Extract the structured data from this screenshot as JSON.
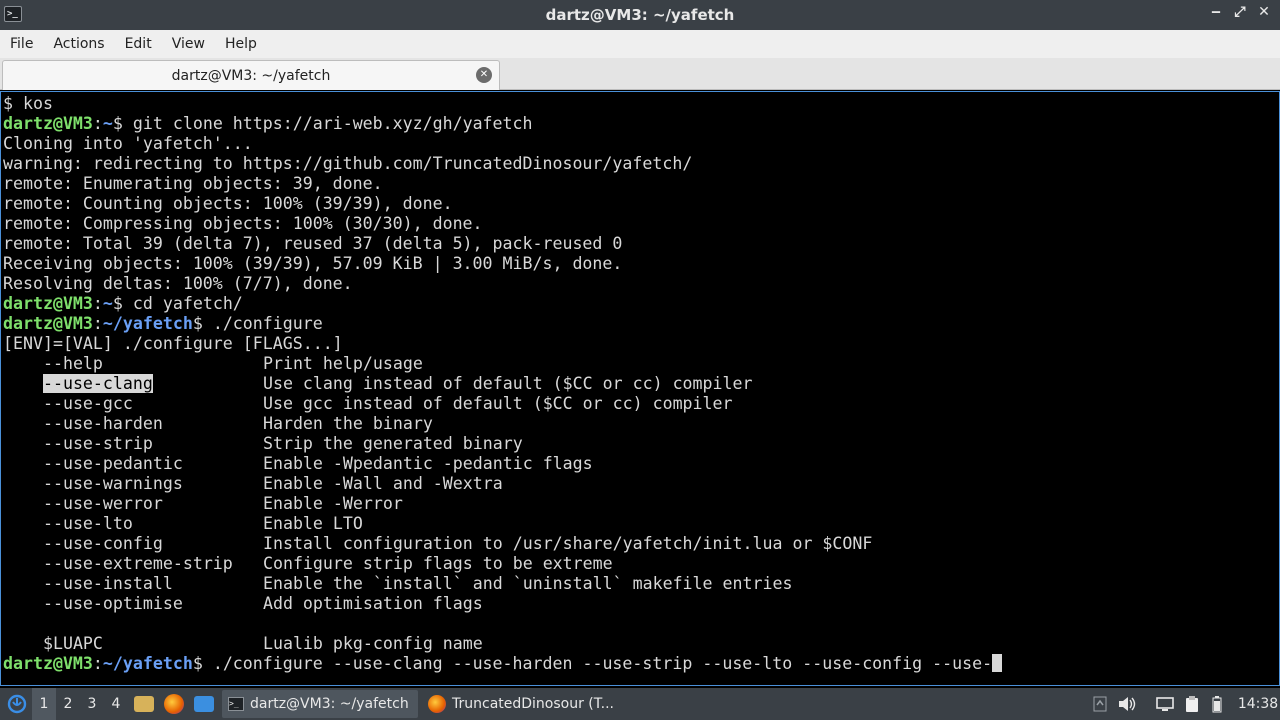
{
  "window": {
    "title": "dartz@VM3: ~/yafetch",
    "app_icon_glyph": ">_",
    "controls": {
      "minimize": "‒",
      "maximize": "⤢",
      "close": "✕"
    }
  },
  "menu": [
    "File",
    "Actions",
    "Edit",
    "View",
    "Help"
  ],
  "tab": {
    "label": "dartz@VM3: ~/yafetch",
    "close_glyph": "✕"
  },
  "terminal": {
    "prompt_user": "dartz@VM3",
    "lines": [
      "$ kos",
      {
        "path": "~",
        "cmd": "git clone https://ari-web.xyz/gh/yafetch"
      },
      "Cloning into 'yafetch'...",
      "warning: redirecting to https://github.com/TruncatedDinosour/yafetch/",
      "remote: Enumerating objects: 39, done.",
      "remote: Counting objects: 100% (39/39), done.",
      "remote: Compressing objects: 100% (30/30), done.",
      "remote: Total 39 (delta 7), reused 37 (delta 5), pack-reused 0",
      "Receiving objects: 100% (39/39), 57.09 KiB | 3.00 MiB/s, done.",
      "Resolving deltas: 100% (7/7), done.",
      {
        "path": "~",
        "cmd": "cd yafetch/"
      },
      {
        "path": "~/yafetch",
        "cmd": "./configure"
      },
      "[ENV]=[VAL] ./configure [FLAGS...]"
    ],
    "options": [
      {
        "flag": "--help",
        "desc": "Print help/usage"
      },
      {
        "flag": "--use-clang",
        "desc": "Use clang instead of default ($CC or cc) compiler",
        "highlight": true
      },
      {
        "flag": "--use-gcc",
        "desc": "Use gcc instead of default ($CC or cc) compiler"
      },
      {
        "flag": "--use-harden",
        "desc": "Harden the binary"
      },
      {
        "flag": "--use-strip",
        "desc": "Strip the generated binary"
      },
      {
        "flag": "--use-pedantic",
        "desc": "Enable -Wpedantic -pedantic flags"
      },
      {
        "flag": "--use-warnings",
        "desc": "Enable -Wall and -Wextra"
      },
      {
        "flag": "--use-werror",
        "desc": "Enable -Werror"
      },
      {
        "flag": "--use-lto",
        "desc": "Enable LTO"
      },
      {
        "flag": "--use-config",
        "desc": "Install configuration to /usr/share/yafetch/init.lua or $CONF"
      },
      {
        "flag": "--use-extreme-strip",
        "desc": "Configure strip flags to be extreme"
      },
      {
        "flag": "--use-install",
        "desc": "Enable the `install` and `uninstall` makefile entries"
      },
      {
        "flag": "--use-optimise",
        "desc": "Add optimisation flags"
      },
      {
        "flag": "",
        "desc": ""
      },
      {
        "flag": "$LUAPC",
        "desc": "Lualib pkg-config name"
      }
    ],
    "current_input": {
      "path": "~/yafetch",
      "cmd": "./configure --use-clang --use-harden --use-strip --use-lto --use-config --use-"
    }
  },
  "taskbar": {
    "workspaces": [
      "1",
      "2",
      "3",
      "4"
    ],
    "active_workspace": "1",
    "tasks": [
      {
        "label": "dartz@VM3: ~/yafetch",
        "icon": "terminal-icon",
        "active": true
      },
      {
        "label": "TruncatedDinosour (T...",
        "icon": "firefox-icon",
        "active": false
      }
    ],
    "clock": "14:38",
    "colors": {
      "firefox": "#e66000",
      "files": "#d7b25a",
      "desktop": "#3b8fe0",
      "start": "#3a8ee6"
    }
  }
}
